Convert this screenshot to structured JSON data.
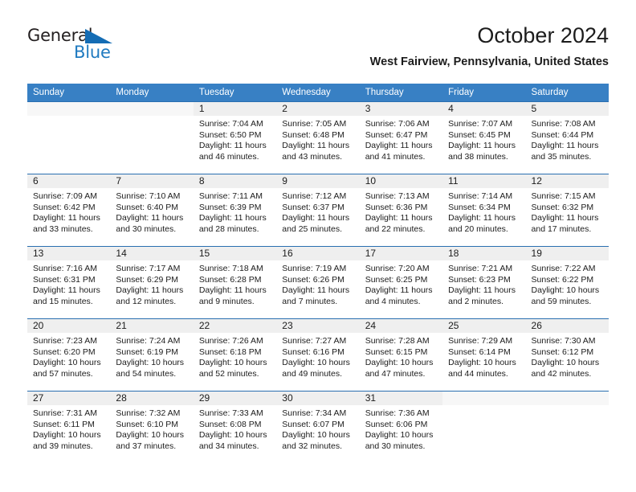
{
  "brand": {
    "name_part1": "General",
    "name_part2": "Blue",
    "triangle_color": "#146cb4",
    "blue_text_color": "#1f7ac0"
  },
  "header": {
    "title": "October 2024",
    "subtitle": "West Fairview, Pennsylvania, United States"
  },
  "theme": {
    "header_bar_color": "#3880c4",
    "row_divider_color": "#2a6fb0",
    "daynum_band_color": "#efefef",
    "text_color": "#1c1c1c"
  },
  "weekdays": [
    "Sunday",
    "Monday",
    "Tuesday",
    "Wednesday",
    "Thursday",
    "Friday",
    "Saturday"
  ],
  "weeks": [
    [
      {
        "day": "",
        "lines": []
      },
      {
        "day": "",
        "lines": []
      },
      {
        "day": "1",
        "lines": [
          "Sunrise: 7:04 AM",
          "Sunset: 6:50 PM",
          "Daylight: 11 hours",
          "and 46 minutes."
        ]
      },
      {
        "day": "2",
        "lines": [
          "Sunrise: 7:05 AM",
          "Sunset: 6:48 PM",
          "Daylight: 11 hours",
          "and 43 minutes."
        ]
      },
      {
        "day": "3",
        "lines": [
          "Sunrise: 7:06 AM",
          "Sunset: 6:47 PM",
          "Daylight: 11 hours",
          "and 41 minutes."
        ]
      },
      {
        "day": "4",
        "lines": [
          "Sunrise: 7:07 AM",
          "Sunset: 6:45 PM",
          "Daylight: 11 hours",
          "and 38 minutes."
        ]
      },
      {
        "day": "5",
        "lines": [
          "Sunrise: 7:08 AM",
          "Sunset: 6:44 PM",
          "Daylight: 11 hours",
          "and 35 minutes."
        ]
      }
    ],
    [
      {
        "day": "6",
        "lines": [
          "Sunrise: 7:09 AM",
          "Sunset: 6:42 PM",
          "Daylight: 11 hours",
          "and 33 minutes."
        ]
      },
      {
        "day": "7",
        "lines": [
          "Sunrise: 7:10 AM",
          "Sunset: 6:40 PM",
          "Daylight: 11 hours",
          "and 30 minutes."
        ]
      },
      {
        "day": "8",
        "lines": [
          "Sunrise: 7:11 AM",
          "Sunset: 6:39 PM",
          "Daylight: 11 hours",
          "and 28 minutes."
        ]
      },
      {
        "day": "9",
        "lines": [
          "Sunrise: 7:12 AM",
          "Sunset: 6:37 PM",
          "Daylight: 11 hours",
          "and 25 minutes."
        ]
      },
      {
        "day": "10",
        "lines": [
          "Sunrise: 7:13 AM",
          "Sunset: 6:36 PM",
          "Daylight: 11 hours",
          "and 22 minutes."
        ]
      },
      {
        "day": "11",
        "lines": [
          "Sunrise: 7:14 AM",
          "Sunset: 6:34 PM",
          "Daylight: 11 hours",
          "and 20 minutes."
        ]
      },
      {
        "day": "12",
        "lines": [
          "Sunrise: 7:15 AM",
          "Sunset: 6:32 PM",
          "Daylight: 11 hours",
          "and 17 minutes."
        ]
      }
    ],
    [
      {
        "day": "13",
        "lines": [
          "Sunrise: 7:16 AM",
          "Sunset: 6:31 PM",
          "Daylight: 11 hours",
          "and 15 minutes."
        ]
      },
      {
        "day": "14",
        "lines": [
          "Sunrise: 7:17 AM",
          "Sunset: 6:29 PM",
          "Daylight: 11 hours",
          "and 12 minutes."
        ]
      },
      {
        "day": "15",
        "lines": [
          "Sunrise: 7:18 AM",
          "Sunset: 6:28 PM",
          "Daylight: 11 hours",
          "and 9 minutes."
        ]
      },
      {
        "day": "16",
        "lines": [
          "Sunrise: 7:19 AM",
          "Sunset: 6:26 PM",
          "Daylight: 11 hours",
          "and 7 minutes."
        ]
      },
      {
        "day": "17",
        "lines": [
          "Sunrise: 7:20 AM",
          "Sunset: 6:25 PM",
          "Daylight: 11 hours",
          "and 4 minutes."
        ]
      },
      {
        "day": "18",
        "lines": [
          "Sunrise: 7:21 AM",
          "Sunset: 6:23 PM",
          "Daylight: 11 hours",
          "and 2 minutes."
        ]
      },
      {
        "day": "19",
        "lines": [
          "Sunrise: 7:22 AM",
          "Sunset: 6:22 PM",
          "Daylight: 10 hours",
          "and 59 minutes."
        ]
      }
    ],
    [
      {
        "day": "20",
        "lines": [
          "Sunrise: 7:23 AM",
          "Sunset: 6:20 PM",
          "Daylight: 10 hours",
          "and 57 minutes."
        ]
      },
      {
        "day": "21",
        "lines": [
          "Sunrise: 7:24 AM",
          "Sunset: 6:19 PM",
          "Daylight: 10 hours",
          "and 54 minutes."
        ]
      },
      {
        "day": "22",
        "lines": [
          "Sunrise: 7:26 AM",
          "Sunset: 6:18 PM",
          "Daylight: 10 hours",
          "and 52 minutes."
        ]
      },
      {
        "day": "23",
        "lines": [
          "Sunrise: 7:27 AM",
          "Sunset: 6:16 PM",
          "Daylight: 10 hours",
          "and 49 minutes."
        ]
      },
      {
        "day": "24",
        "lines": [
          "Sunrise: 7:28 AM",
          "Sunset: 6:15 PM",
          "Daylight: 10 hours",
          "and 47 minutes."
        ]
      },
      {
        "day": "25",
        "lines": [
          "Sunrise: 7:29 AM",
          "Sunset: 6:14 PM",
          "Daylight: 10 hours",
          "and 44 minutes."
        ]
      },
      {
        "day": "26",
        "lines": [
          "Sunrise: 7:30 AM",
          "Sunset: 6:12 PM",
          "Daylight: 10 hours",
          "and 42 minutes."
        ]
      }
    ],
    [
      {
        "day": "27",
        "lines": [
          "Sunrise: 7:31 AM",
          "Sunset: 6:11 PM",
          "Daylight: 10 hours",
          "and 39 minutes."
        ]
      },
      {
        "day": "28",
        "lines": [
          "Sunrise: 7:32 AM",
          "Sunset: 6:10 PM",
          "Daylight: 10 hours",
          "and 37 minutes."
        ]
      },
      {
        "day": "29",
        "lines": [
          "Sunrise: 7:33 AM",
          "Sunset: 6:08 PM",
          "Daylight: 10 hours",
          "and 34 minutes."
        ]
      },
      {
        "day": "30",
        "lines": [
          "Sunrise: 7:34 AM",
          "Sunset: 6:07 PM",
          "Daylight: 10 hours",
          "and 32 minutes."
        ]
      },
      {
        "day": "31",
        "lines": [
          "Sunrise: 7:36 AM",
          "Sunset: 6:06 PM",
          "Daylight: 10 hours",
          "and 30 minutes."
        ]
      },
      {
        "day": "",
        "lines": []
      },
      {
        "day": "",
        "lines": []
      }
    ]
  ]
}
